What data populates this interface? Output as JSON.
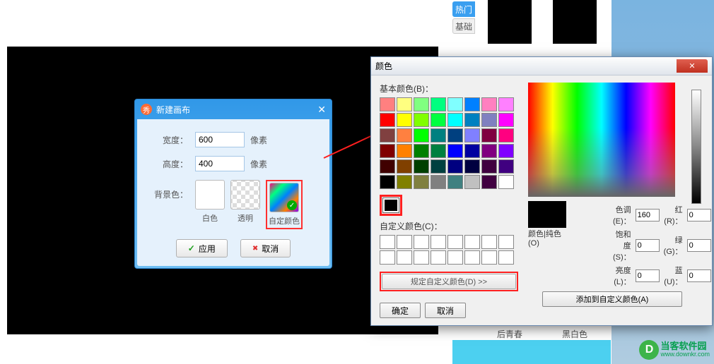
{
  "side_tabs": {
    "hot": "热门",
    "basic": "基础"
  },
  "thumb_labels": {
    "youth": "后青春",
    "bw": "黑白色"
  },
  "logo": {
    "cn": "当客软件园",
    "url": "www.downkr.com",
    "letter": "D"
  },
  "dlg1": {
    "title": "新建画布",
    "width_label": "宽度：",
    "width_value": "600",
    "width_unit": "像素",
    "height_label": "高度：",
    "height_value": "400",
    "height_unit": "像素",
    "bg_label": "背景色：",
    "opt_white": "白色",
    "opt_trans": "透明",
    "opt_custom": "自定颜色",
    "apply": "应用",
    "cancel": "取消"
  },
  "dlg2": {
    "title": "颜色",
    "basic_label": "基本颜色(B)：",
    "custom_label": "自定义颜色(C)：",
    "define": "规定自定义颜色(D) >>",
    "ok": "确定",
    "cancel": "取消",
    "preview_label": "颜色|纯色(O)",
    "hue_label": "色调(E)：",
    "hue": "160",
    "sat_label": "饱和度(S)：",
    "sat": "0",
    "lum_label": "亮度(L)：",
    "lum": "0",
    "red_label": "红(R)：",
    "red": "0",
    "green_label": "绿(G)：",
    "green": "0",
    "blue_label": "蓝(U)：",
    "blue": "0",
    "add": "添加到自定义颜色(A)"
  },
  "basic_colors": [
    "#ff8080",
    "#ffff80",
    "#80ff80",
    "#00ff80",
    "#80ffff",
    "#0080ff",
    "#ff80c0",
    "#ff80ff",
    "#ff0000",
    "#ffff00",
    "#80ff00",
    "#00ff40",
    "#00ffff",
    "#0080c0",
    "#8080c0",
    "#ff00ff",
    "#804040",
    "#ff8040",
    "#00ff00",
    "#008080",
    "#004080",
    "#8080ff",
    "#800040",
    "#ff0080",
    "#800000",
    "#ff8000",
    "#008000",
    "#008040",
    "#0000ff",
    "#0000a0",
    "#800080",
    "#8000ff",
    "#400000",
    "#804000",
    "#004000",
    "#004040",
    "#000080",
    "#000040",
    "#400040",
    "#400080",
    "#000000",
    "#808000",
    "#808040",
    "#808080",
    "#408080",
    "#c0c0c0",
    "#400040",
    "#ffffff"
  ]
}
